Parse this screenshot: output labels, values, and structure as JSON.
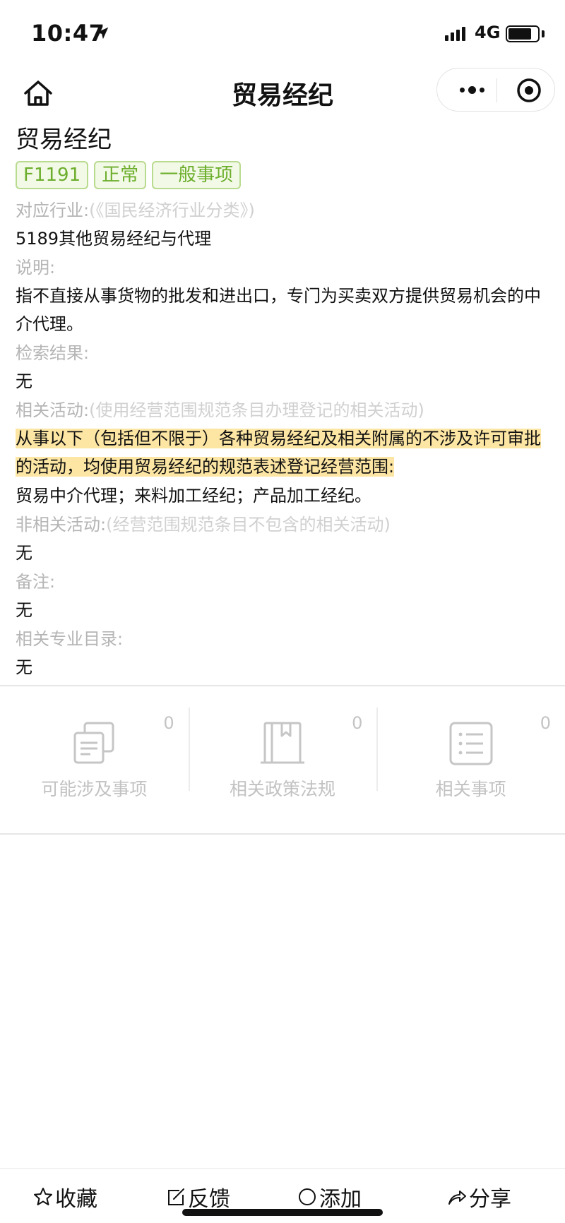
{
  "status_bar": {
    "time": "10:47",
    "network": "4G"
  },
  "nav": {
    "title": "贸易经纪"
  },
  "detail": {
    "title": "贸易经纪",
    "tags": [
      "F1191",
      "正常",
      "一般事项"
    ],
    "industry_label": "对应行业:",
    "industry_hint": "(《国民经济行业分类》)",
    "industry_value": "5189其他贸易经纪与代理",
    "description_label": "说明:",
    "description_value": "指不直接从事货物的批发和进出口，专门为买卖双方提供贸易机会的中介代理。",
    "search_result_label": "检索结果:",
    "search_result_value": "无",
    "related_activity_label": "相关活动:",
    "related_activity_hint": "(使用经营范围规范条目办理登记的相关活动)",
    "related_activity_highlight": "从事以下（包括但不限于）各种贸易经纪及相关附属的不涉及许可审批的活动，均使用贸易经纪的规范表述登记经营范围:",
    "related_activity_value": "贸易中介代理；来料加工经纪；产品加工经纪。",
    "unrelated_activity_label": "非相关活动:",
    "unrelated_activity_hint": "(经营范围规范条目不包含的相关活动)",
    "unrelated_activity_value": "无",
    "remark_label": "备注:",
    "remark_value": "无",
    "catalog_label": "相关专业目录:",
    "catalog_value": "无"
  },
  "related": {
    "possible_items": {
      "label": "可能涉及事项",
      "count": "0"
    },
    "policies": {
      "label": "相关政策法规",
      "count": "0"
    },
    "items": {
      "label": "相关事项",
      "count": "0"
    }
  },
  "toolbar": {
    "favorite": "收藏",
    "feedback": "反馈",
    "add": "添加",
    "share": "分享"
  },
  "colors": {
    "tag_text": "#6cae2c",
    "tag_border": "#b9db8f",
    "tag_bg": "#f2f9e6",
    "highlight": "#fde6a4",
    "muted": "#b5b5b5"
  }
}
